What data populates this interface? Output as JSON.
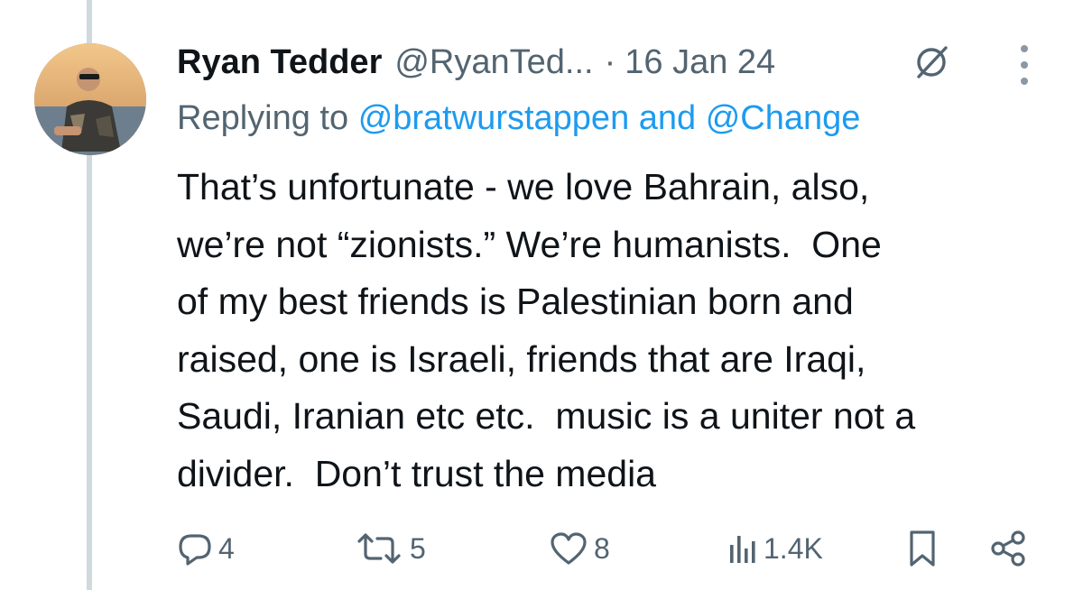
{
  "tweet": {
    "display_name": "Ryan Tedder",
    "handle": "@RyanTed...",
    "separator": "·",
    "date": "16 Jan 24",
    "replying_prefix": "Replying to",
    "replying_to_1": "@bratwurstappen",
    "replying_and": "and",
    "replying_to_2": "@Change",
    "text_lines": [
      "That’s unfortunate - we love Bahrain, also,",
      "we’re not “zionists.” We’re humanists.  One",
      "of my best friends is Palestinian born and",
      "raised, one is Israeli, friends that are Iraqi,",
      "Saudi, Iranian etc etc.  music is a uniter not a",
      "divider.  Don’t trust the media"
    ]
  },
  "actions": {
    "replies": "4",
    "reposts": "5",
    "likes": "8",
    "views": "1.4K"
  },
  "icons": {
    "reply": "reply-icon",
    "repost": "repost-icon",
    "like": "heart-icon",
    "views": "views-icon",
    "bookmark": "bookmark-icon",
    "share": "share-icon",
    "more": "more-icon",
    "grok": "grok-icon"
  },
  "colors": {
    "text": "#0f1419",
    "secondary": "#536471",
    "link": "#1d9bf0",
    "thread_line": "#cfd9de"
  }
}
